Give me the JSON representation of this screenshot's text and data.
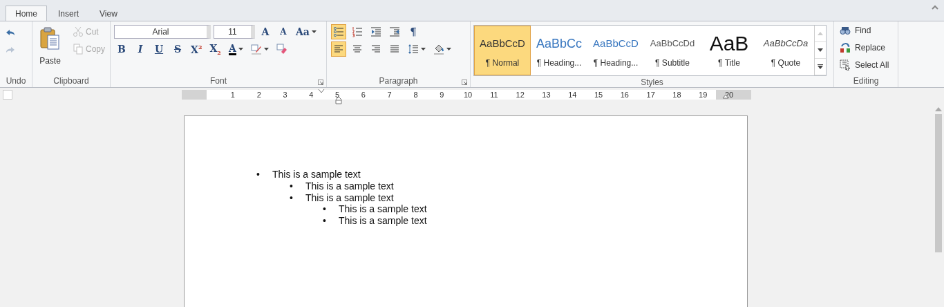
{
  "tabs": [
    {
      "label": "Home",
      "selected": true
    },
    {
      "label": "Insert",
      "selected": false
    },
    {
      "label": "View",
      "selected": false
    }
  ],
  "undo": {
    "label": "Undo",
    "buttons": [
      {
        "kind": "undo",
        "disabled": false
      },
      {
        "kind": "redo",
        "disabled": true
      }
    ]
  },
  "clipboard": {
    "label": "Clipboard",
    "paste": {
      "label": "Paste",
      "disabled": false
    },
    "buttons": [
      {
        "kind": "cut",
        "label": "Cut",
        "disabled": true
      },
      {
        "kind": "copy",
        "label": "Copy",
        "disabled": true
      }
    ]
  },
  "font": {
    "label": "Font",
    "font_name": "Arial",
    "font_size": "11",
    "row1": [
      {
        "kind": "grow",
        "label": "A"
      },
      {
        "kind": "shrink",
        "label": "A"
      },
      {
        "kind": "case",
        "label": "Aa",
        "dropdown": true
      }
    ],
    "row2": [
      {
        "kind": "bold",
        "label": "B"
      },
      {
        "kind": "italic",
        "label": "I"
      },
      {
        "kind": "underline",
        "label": "U"
      },
      {
        "kind": "strike",
        "label": "S"
      },
      {
        "kind": "superscript",
        "label": "X$^{2}$"
      },
      {
        "kind": "subscript",
        "label": "X$_{2}$"
      },
      {
        "kind": "color",
        "label": "A",
        "dropdown": true
      },
      {
        "kind": "highlight",
        "dropdown": true
      },
      {
        "kind": "clear"
      }
    ]
  },
  "paragraph": {
    "label": "Paragraph",
    "row1": [
      {
        "kind": "bullets",
        "selected": true
      },
      {
        "kind": "numbering",
        "selected": false
      },
      {
        "kind": "outdent",
        "selected": false
      },
      {
        "kind": "indent",
        "selected": false
      },
      {
        "kind": "marks",
        "label": "¶",
        "selected": false
      }
    ],
    "row2": [
      {
        "kind": "align-left",
        "selected": true
      },
      {
        "kind": "align-center",
        "selected": false
      },
      {
        "kind": "align-right",
        "selected": false
      },
      {
        "kind": "justify",
        "selected": false
      },
      {
        "kind": "line-spacing",
        "selected": false,
        "dropdown": true
      },
      {
        "kind": "shading",
        "selected": false,
        "dropdown": true
      }
    ]
  },
  "styles": {
    "label": "Styles",
    "items": [
      {
        "kind": "normal",
        "preview": "AaBbCcD",
        "label": "¶ Normal",
        "selected": true
      },
      {
        "kind": "heading1",
        "preview": "AaBbCc",
        "label": "¶ Heading...",
        "selected": false
      },
      {
        "kind": "heading2",
        "preview": "AaBbCcD",
        "label": "¶ Heading...",
        "selected": false
      },
      {
        "kind": "subtitle",
        "preview": "AaBbCcDd",
        "label": "¶ Subtitle",
        "selected": false
      },
      {
        "kind": "title",
        "preview": "AaB",
        "label": "¶ Title",
        "selected": false
      },
      {
        "kind": "quote",
        "preview": "AaBbCcDa",
        "label": "¶ Quote",
        "selected": false
      }
    ]
  },
  "editing": {
    "label": "Editing",
    "buttons": [
      {
        "kind": "find",
        "label": "Find"
      },
      {
        "kind": "replace",
        "label": "Replace"
      },
      {
        "kind": "select-all",
        "label": "Select All"
      }
    ]
  },
  "ruler": {
    "numbers": [
      "1",
      "2",
      "3",
      "4",
      "5",
      "6",
      "7",
      "8",
      "9",
      "10",
      "11",
      "12",
      "13",
      "14",
      "15",
      "16",
      "17",
      "18",
      "19",
      "20"
    ]
  },
  "document": {
    "list": [
      {
        "bullet": "•",
        "text": "This is a sample text",
        "children": [
          {
            "bullet": "•",
            "text": "This is a sample text"
          },
          {
            "bullet": "•",
            "text": "This is a sample text",
            "children": [
              {
                "bullet": "•",
                "text": "This is a sample text"
              },
              {
                "bullet": "•",
                "text": "This is a sample text"
              }
            ]
          }
        ]
      }
    ]
  }
}
